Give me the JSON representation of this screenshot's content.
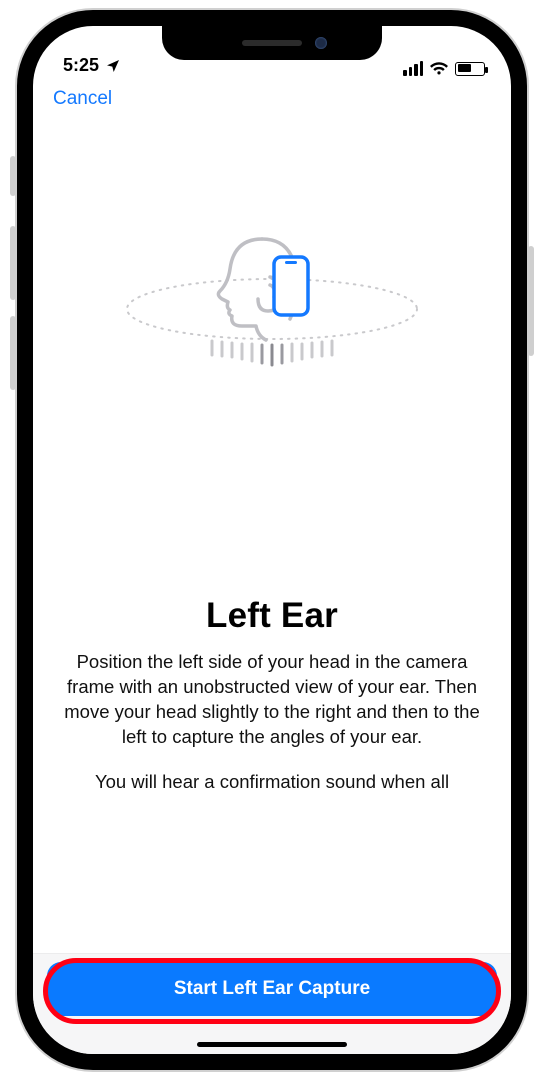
{
  "status": {
    "time": "5:25",
    "location_arrow": "➤"
  },
  "nav": {
    "cancel": "Cancel"
  },
  "content": {
    "title": "Left Ear",
    "body1": "Position the left side of your head in the camera frame with an unobstructed view of your ear. Then move your head slightly to the right and then to the left to capture the angles of your ear.",
    "body2": "You will hear a confirmation sound when all"
  },
  "button": {
    "primary": "Start Left Ear Capture"
  },
  "colors": {
    "accent": "#0a7aff",
    "link": "#1479ff",
    "highlight": "#ff0014"
  },
  "icons": {
    "location": "location-arrow-icon",
    "signal": "cellular-signal-icon",
    "wifi": "wifi-icon",
    "battery": "battery-icon",
    "head": "head-profile-icon",
    "phone": "phone-outline-icon"
  }
}
